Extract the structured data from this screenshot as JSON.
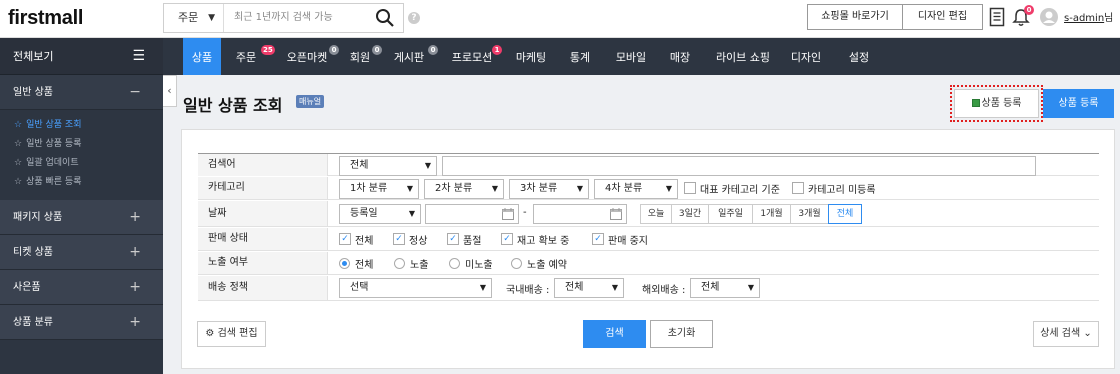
{
  "app": {
    "logo": "firstmall"
  },
  "search": {
    "scope": "주문",
    "placeholder": "최근 1년까지 검색 가능"
  },
  "header": {
    "shop_link": "쇼핑몰 바로가기",
    "design_edit": "디자인 편집",
    "notif_count": "0",
    "username": "s-admin",
    "suffix": "님"
  },
  "sidebar": {
    "title": "전체보기",
    "sections": [
      {
        "label": "일반 상품",
        "toggle": "−"
      },
      {
        "label": "패키지 상품",
        "toggle": "+"
      },
      {
        "label": "티켓 상품",
        "toggle": "+"
      },
      {
        "label": "사은품",
        "toggle": "+"
      },
      {
        "label": "상품 분류",
        "toggle": "+"
      }
    ],
    "items": [
      "일반 상품 조회",
      "일반 상품 등록",
      "일괄 업데이트",
      "상품 빠른 등록"
    ]
  },
  "gnb": [
    {
      "label": "상품",
      "badge": ""
    },
    {
      "label": "주문",
      "badge": "25"
    },
    {
      "label": "오픈마켓",
      "badge": "0"
    },
    {
      "label": "회원",
      "badge": "0"
    },
    {
      "label": "게시판",
      "badge": "0"
    },
    {
      "label": "프로모션",
      "badge": "1"
    },
    {
      "label": "마케팅",
      "badge": ""
    },
    {
      "label": "통계",
      "badge": ""
    },
    {
      "label": "모바일",
      "badge": ""
    },
    {
      "label": "매장",
      "badge": ""
    },
    {
      "label": "라이브 쇼핑",
      "badge": ""
    },
    {
      "label": "디자인",
      "badge": ""
    },
    {
      "label": "설정",
      "badge": ""
    }
  ],
  "page": {
    "title": "일반 상품 조회",
    "manual": "매뉴얼",
    "register": "상품 등록",
    "register2": "상품 등록"
  },
  "form": {
    "keyword": {
      "label": "검색어",
      "select": "전체"
    },
    "category": {
      "label": "카테고리",
      "sel1": "1차 분류",
      "sel2": "2차 분류",
      "sel3": "3차 분류",
      "sel4": "4차 분류",
      "chk1": "대표 카테고리 기준",
      "chk2": "카테고리 미등록"
    },
    "date": {
      "label": "날짜",
      "select": "등록일",
      "dash": "-",
      "periods": [
        "오늘",
        "3일간",
        "일주일",
        "1개월",
        "3개월",
        "전체"
      ]
    },
    "status": {
      "label": "판매 상태",
      "options": [
        "전체",
        "정상",
        "품절",
        "재고 확보 중",
        "판매 중지"
      ]
    },
    "exposure": {
      "label": "노출 여부",
      "options": [
        "전체",
        "노출",
        "미노출",
        "노출 예약"
      ]
    },
    "shipping": {
      "label": "배송 정책",
      "select": "선택",
      "domestic_label": "국내배송 :",
      "domestic": "전체",
      "overseas_label": "해외배송 :",
      "overseas": "전체"
    }
  },
  "buttons": {
    "edit_search": "검색 편집",
    "search": "검색",
    "reset": "초기화",
    "detail": "상세 검색"
  }
}
